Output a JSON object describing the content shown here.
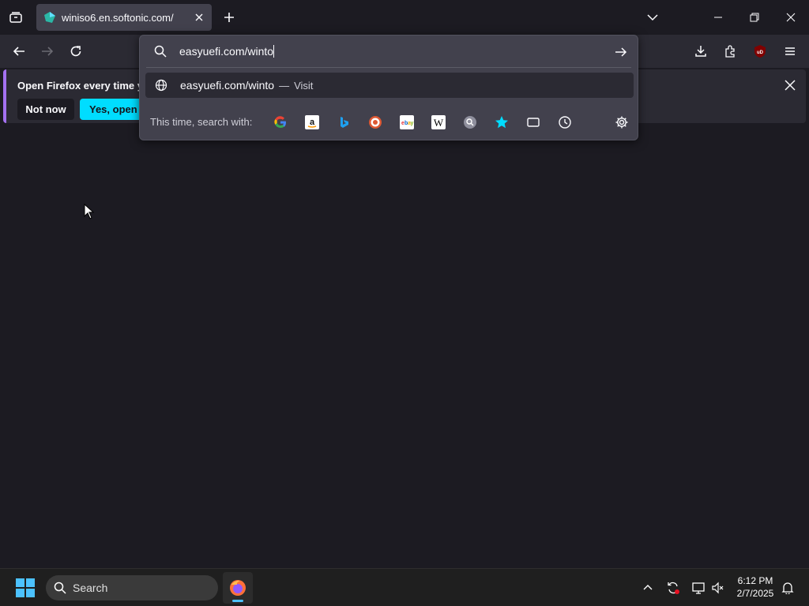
{
  "tab": {
    "title": "winiso6.en.softonic.com/"
  },
  "urlbar": {
    "value": "easyuefi.com/winto"
  },
  "suggestion": {
    "url": "easyuefi.com/winto",
    "separator": "—",
    "action": "Visit"
  },
  "search_engines": {
    "label": "This time, search with:",
    "items": [
      "google-icon",
      "amazon-icon",
      "bing-icon",
      "duckduckgo-icon",
      "ebay-icon",
      "wikipedia-icon",
      "search-engine-icon",
      "bookmarks-star-icon",
      "tabs-icon",
      "history-clock-icon"
    ]
  },
  "notification": {
    "message": "Open Firefox every time you",
    "not_now": "Not now",
    "yes_open": "Yes, open Fir"
  },
  "taskbar": {
    "search_placeholder": "Search",
    "time": "6:12 PM",
    "date": "2/7/2025"
  },
  "colors": {
    "accent": "#00ddff",
    "background": "#1c1b22",
    "toolbar": "#2b2a33",
    "panel": "#42414d",
    "ublock": "#800000"
  }
}
